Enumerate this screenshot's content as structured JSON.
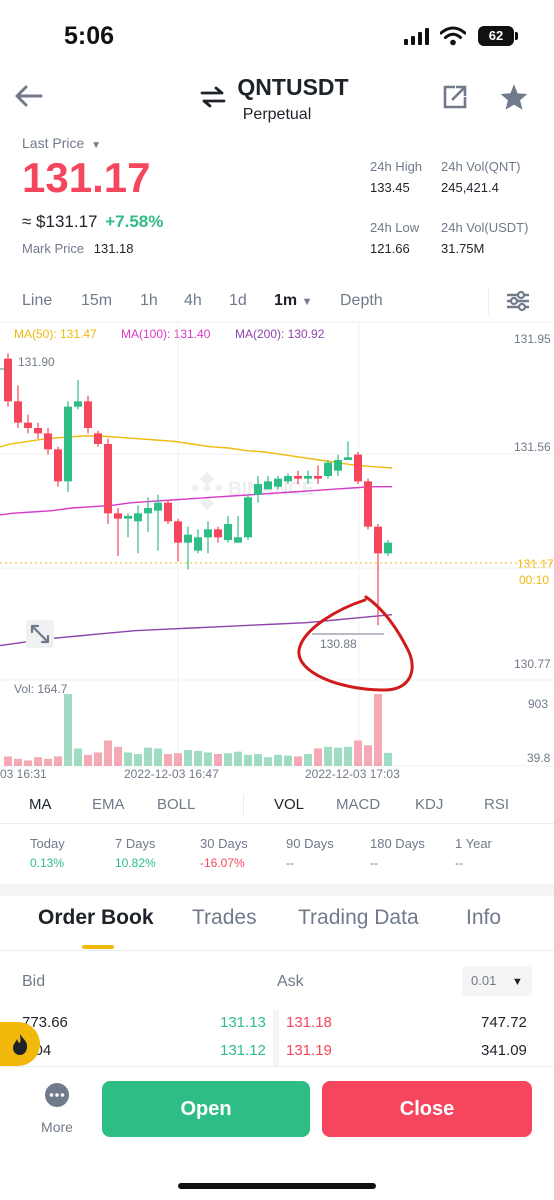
{
  "status_bar": {
    "time": "5:06",
    "battery": "62"
  },
  "header": {
    "symbol": "QNTUSDT",
    "contract": "Perpetual"
  },
  "price": {
    "last_price_label": "Last Price",
    "last_price": "131.17",
    "usd_price": "≈ $131.17",
    "change": "+7.58%",
    "mark_price_label": "Mark Price",
    "mark_price": "131.18"
  },
  "stats": {
    "high_label": "24h High",
    "high": "133.45",
    "vol_qnt_label": "24h Vol(QNT)",
    "vol_qnt": "245,421.4",
    "low_label": "24h Low",
    "low": "121.66",
    "vol_usdt_label": "24h Vol(USDT)",
    "vol_usdt": "31.75M"
  },
  "timeframes": [
    "Line",
    "15m",
    "1h",
    "4h",
    "1d",
    "1m",
    "Depth"
  ],
  "selected_timeframe": "1m",
  "ma_legend": {
    "ma50": "MA(50): 131.47",
    "ma100": "MA(100): 131.40",
    "ma200": "MA(200): 130.92"
  },
  "price_axis": [
    "131.95",
    "131.56",
    "131.17",
    "130.77"
  ],
  "countdown": "00:10",
  "chart_annotations": {
    "high_label": "131.90",
    "low_label": "130.88"
  },
  "watermark": "BINANCE",
  "volume": {
    "label": "Vol: 164.7",
    "axis_top": "903",
    "axis_bottom": "39.8"
  },
  "time_axis": [
    "03 16:31",
    "2022-12-03 16:47",
    "2022-12-03 17:03"
  ],
  "indicators_main": [
    "MA",
    "EMA",
    "BOLL"
  ],
  "indicators_sub": [
    "VOL",
    "MACD",
    "KDJ",
    "RSI"
  ],
  "performance": [
    {
      "label": "Today",
      "value": "0.13%"
    },
    {
      "label": "7 Days",
      "value": "10.82%"
    },
    {
      "label": "30 Days",
      "value": "-16.07%"
    },
    {
      "label": "90 Days",
      "value": "--"
    },
    {
      "label": "180 Days",
      "value": "--"
    },
    {
      "label": "1 Year",
      "value": "--"
    }
  ],
  "tabs": [
    "Order Book",
    "Trades",
    "Trading Data",
    "Info"
  ],
  "order_book": {
    "bid_label": "Bid",
    "ask_label": "Ask",
    "precision": "0.01",
    "rows": [
      {
        "bid_qty": "773.66",
        "bid_price": "131.13",
        "ask_price": "131.18",
        "ask_qty": "747.72"
      },
      {
        "bid_qty": "8.04",
        "bid_price": "131.12",
        "ask_price": "131.19",
        "ask_qty": "341.09"
      }
    ]
  },
  "bottom_bar": {
    "more_label": "More",
    "open_label": "Open",
    "close_label": "Close"
  },
  "colors": {
    "up": "#2ebd85",
    "down": "#f6465d",
    "ma50": "#f0b90b",
    "ma100": "#d63ac6",
    "ma200": "#8e44ad",
    "accent": "#f0b90b"
  },
  "chart_data": {
    "type": "candlestick",
    "ylim": [
      130.72,
      131.95
    ],
    "series": [
      {
        "name": "MA(50)",
        "values": [
          131.54,
          131.56,
          131.57,
          131.58,
          131.585,
          131.59,
          131.59,
          131.585,
          131.58,
          131.575,
          131.57,
          131.56,
          131.55,
          131.545,
          131.535,
          131.53,
          131.52,
          131.51,
          131.5,
          131.49,
          131.48,
          131.475,
          131.47
        ]
      },
      {
        "name": "MA(100)",
        "values": [
          131.29,
          131.3,
          131.305,
          131.31,
          131.32,
          131.325,
          131.33,
          131.34,
          131.345,
          131.35,
          131.355,
          131.36,
          131.365,
          131.37,
          131.375,
          131.38,
          131.385,
          131.39,
          131.395,
          131.4,
          131.4
        ]
      },
      {
        "name": "MA(200)",
        "values": [
          130.8,
          130.815,
          130.83,
          130.84,
          130.85,
          130.86,
          130.865,
          130.87,
          130.875,
          130.88,
          130.885,
          130.89,
          130.9,
          130.91,
          130.92
        ]
      }
    ],
    "candles": [
      [
        131.88,
        131.72,
        131.9,
        131.7
      ],
      [
        131.72,
        131.64,
        131.78,
        131.62
      ],
      [
        131.64,
        131.62,
        131.67,
        131.6
      ],
      [
        131.62,
        131.6,
        131.64,
        131.58
      ],
      [
        131.6,
        131.54,
        131.62,
        131.52
      ],
      [
        131.54,
        131.42,
        131.55,
        131.4
      ],
      [
        131.42,
        131.7,
        131.72,
        131.38
      ],
      [
        131.7,
        131.72,
        131.8,
        131.69
      ],
      [
        131.72,
        131.62,
        131.74,
        131.6
      ],
      [
        131.6,
        131.56,
        131.61,
        131.55
      ],
      [
        131.56,
        131.3,
        131.58,
        131.26
      ],
      [
        131.3,
        131.28,
        131.32,
        131.14
      ],
      [
        131.28,
        131.29,
        131.3,
        131.21
      ],
      [
        131.27,
        131.3,
        131.33,
        131.15
      ],
      [
        131.3,
        131.32,
        131.36,
        131.23
      ],
      [
        131.31,
        131.34,
        131.37,
        131.16
      ],
      [
        131.34,
        131.27,
        131.35,
        131.26
      ],
      [
        131.27,
        131.19,
        131.28,
        131.12
      ],
      [
        131.19,
        131.22,
        131.25,
        131.09
      ],
      [
        131.16,
        131.21,
        131.24,
        131.15
      ],
      [
        131.21,
        131.24,
        131.27,
        131.15
      ],
      [
        131.24,
        131.21,
        131.25,
        131.19
      ],
      [
        131.2,
        131.26,
        131.29,
        131.19
      ],
      [
        131.19,
        131.21,
        131.29,
        131.19
      ],
      [
        131.21,
        131.36,
        131.37,
        131.2
      ],
      [
        131.37,
        131.41,
        131.44,
        131.34
      ],
      [
        131.39,
        131.42,
        131.44,
        131.39
      ],
      [
        131.4,
        131.43,
        131.44,
        131.39
      ],
      [
        131.42,
        131.44,
        131.45,
        131.41
      ],
      [
        131.44,
        131.43,
        131.46,
        131.41
      ],
      [
        131.43,
        131.44,
        131.46,
        131.41
      ],
      [
        131.44,
        131.43,
        131.48,
        131.41
      ],
      [
        131.44,
        131.49,
        131.5,
        131.43
      ],
      [
        131.46,
        131.5,
        131.52,
        131.44
      ],
      [
        131.5,
        131.51,
        131.57,
        131.5
      ],
      [
        131.52,
        131.42,
        131.53,
        131.41
      ],
      [
        131.42,
        131.25,
        131.43,
        131.24
      ],
      [
        131.25,
        131.15,
        131.26,
        130.88
      ],
      [
        131.15,
        131.19,
        131.2,
        131.14
      ]
    ],
    "volume": [
      120,
      90,
      70,
      110,
      90,
      120,
      903,
      220,
      140,
      170,
      320,
      240,
      170,
      150,
      230,
      220,
      150,
      160,
      200,
      190,
      170,
      150,
      160,
      180,
      140,
      150,
      110,
      140,
      130,
      120,
      150,
      220,
      240,
      230,
      240,
      320,
      260,
      903,
      164.7
    ]
  }
}
